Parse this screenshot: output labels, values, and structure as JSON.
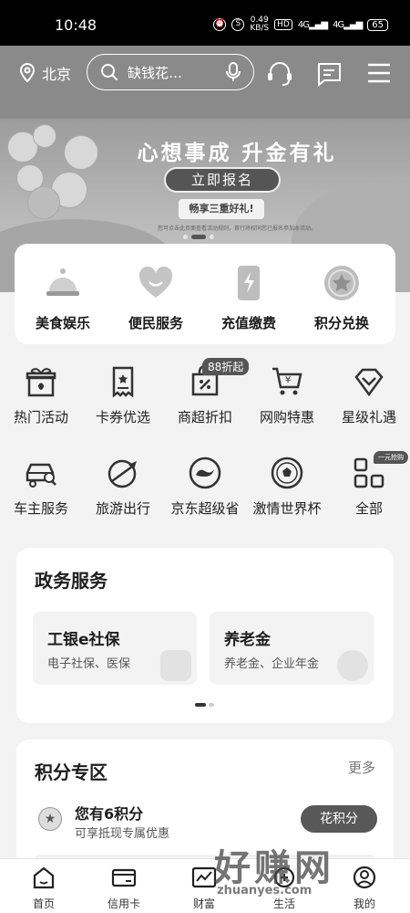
{
  "status_bar": {
    "time": "10:48",
    "speed_value": "0.49",
    "speed_unit": "KB/S",
    "hd": "HD",
    "net1": "4G",
    "net2": "4G",
    "battery": "65"
  },
  "header": {
    "location": "北京",
    "search_placeholder": "缺钱花…"
  },
  "banner": {
    "title": "心想事成  升金有礼",
    "button": "立即报名",
    "subtitle": "畅享三重好礼!",
    "note": "您可点击此页面查看活动规则，首行将权同您已报名参加本活动。"
  },
  "quick_services": [
    {
      "label": "美食娱乐",
      "icon": "cloche-icon"
    },
    {
      "label": "便民服务",
      "icon": "heart-icon"
    },
    {
      "label": "充值缴费",
      "icon": "phone-charge-icon"
    },
    {
      "label": "积分兑换",
      "icon": "star-coin-icon"
    }
  ],
  "grid_row1": [
    {
      "label": "热门活动",
      "icon": "gift-icon"
    },
    {
      "label": "卡券优选",
      "icon": "coupon-icon"
    },
    {
      "label": "商超折扣",
      "icon": "discount-bag-icon",
      "tag": "88折起"
    },
    {
      "label": "网购特惠",
      "icon": "cart-icon"
    },
    {
      "label": "星级礼遇",
      "icon": "diamond-icon"
    }
  ],
  "grid_row2": [
    {
      "label": "车主服务",
      "icon": "car-icon"
    },
    {
      "label": "旅游出行",
      "icon": "travel-icon"
    },
    {
      "label": "京东超级省",
      "icon": "jd-dog-icon"
    },
    {
      "label": "激情世界杯",
      "icon": "football-icon"
    },
    {
      "label": "全部",
      "icon": "grid-all-icon",
      "tag": "一元抢购"
    }
  ],
  "gov_services": {
    "title": "政务服务",
    "items": [
      {
        "title": "工银e社保",
        "desc": "电子社保、医保",
        "icon": "person-card-icon"
      },
      {
        "title": "养老金",
        "desc": "养老金、企业年金",
        "icon": "yen-coin-icon"
      }
    ]
  },
  "points_zone": {
    "title": "积分专区",
    "more": "更多",
    "summary": "您有6积分",
    "desc": "可享抵现专属优惠",
    "button": "花积分"
  },
  "tabbar": [
    {
      "label": "首页",
      "icon": "home-icon"
    },
    {
      "label": "信用卡",
      "icon": "credit-card-icon"
    },
    {
      "label": "财富",
      "icon": "chart-icon"
    },
    {
      "label": "生活",
      "icon": "life-icon"
    },
    {
      "label": "我的",
      "icon": "user-icon"
    }
  ],
  "watermark": {
    "text": "好赚网",
    "url": "zhuanyes.com"
  }
}
